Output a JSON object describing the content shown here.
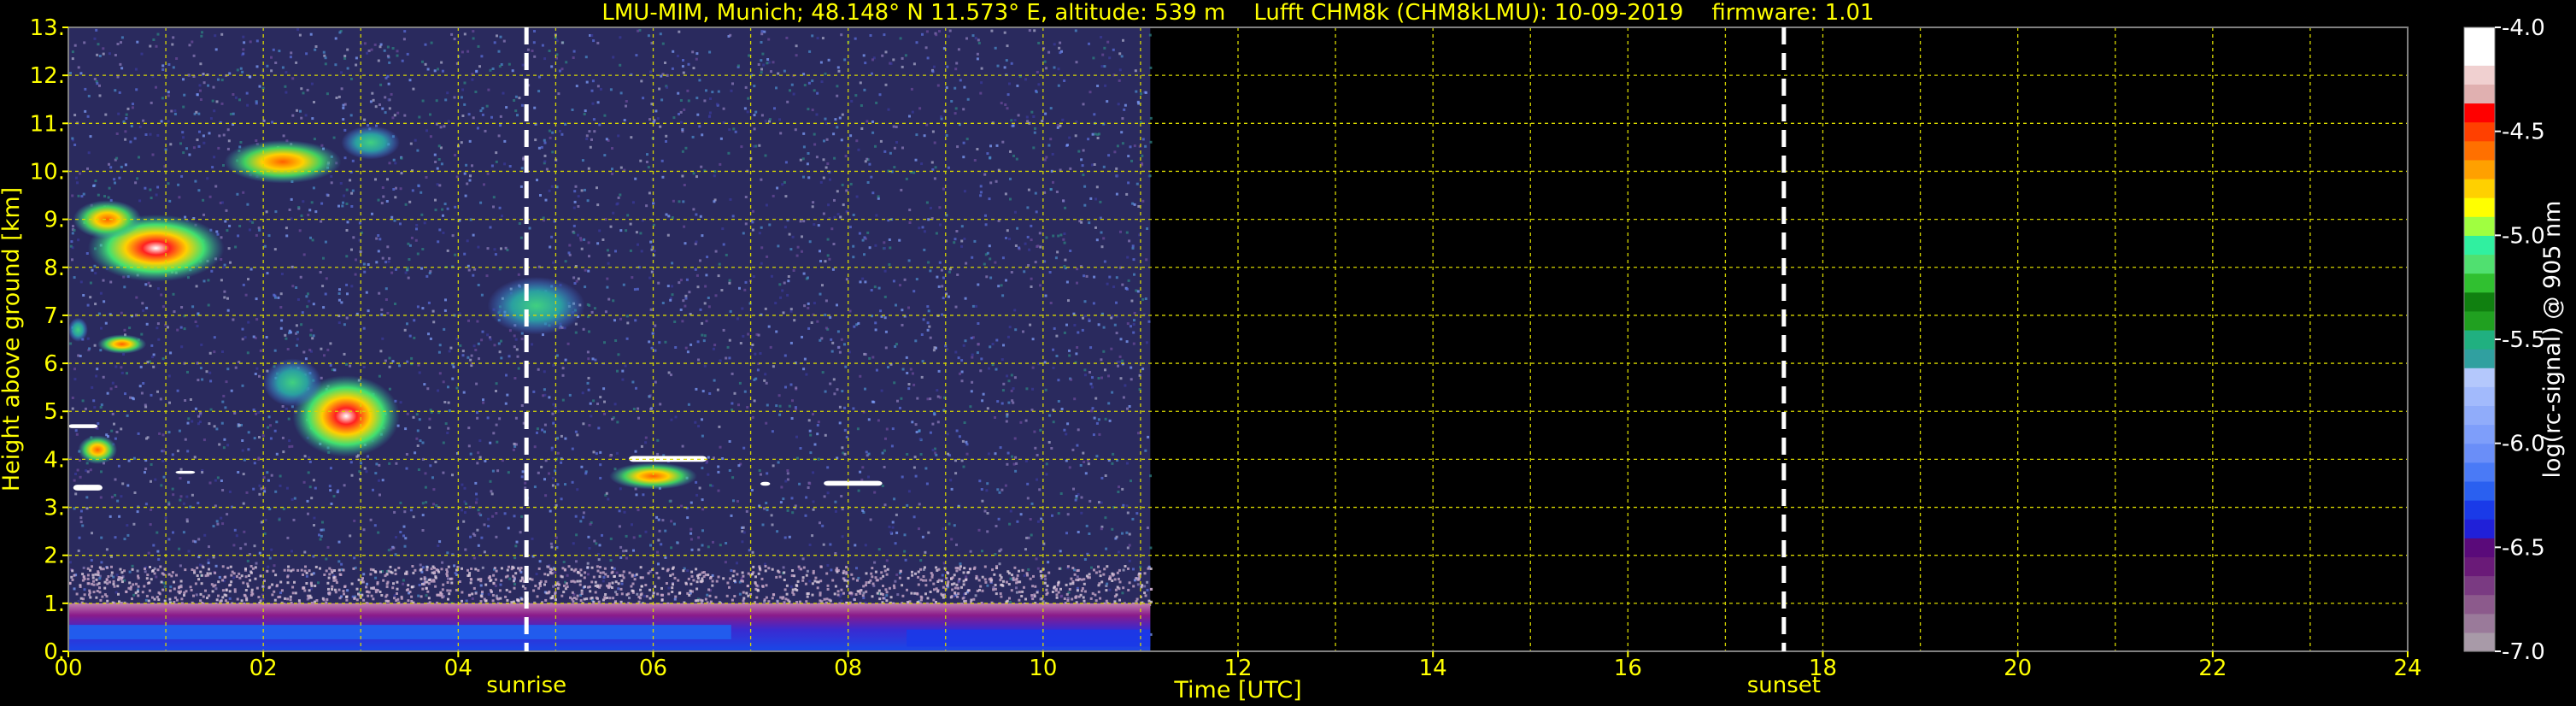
{
  "chart_data": {
    "type": "heatmap",
    "title": "LMU-MIM, Munich; 48.148° N 11.573° E, altitude: 539 m    Lufft CHM8k (CHM8kLMU): 10-09-2019    firmware: 1.01",
    "xlabel": "Time [UTC]",
    "ylabel": "Height above ground [km]",
    "xlim": [
      0,
      24
    ],
    "ylim": [
      0,
      13
    ],
    "x_ticks": [
      "00",
      "02",
      "04",
      "06",
      "08",
      "10",
      "12",
      "14",
      "16",
      "18",
      "20",
      "22",
      "24"
    ],
    "y_ticks": [
      "0.",
      "1.",
      "2.",
      "3.",
      "4.",
      "5.",
      "6.",
      "7.",
      "8.",
      "9.",
      "10.",
      "11.",
      "12.",
      "13."
    ],
    "grid": true,
    "data_end_hour": 11.1,
    "markers": [
      {
        "label": "sunrise",
        "hour": 4.7
      },
      {
        "label": "sunset",
        "hour": 17.6
      }
    ],
    "colorbar": {
      "label": "log(rc-signal) @ 905 nm",
      "range": [
        -7.0,
        -4.0
      ],
      "ticks": [
        "-4.0",
        "-4.5",
        "-5.0",
        "-5.5",
        "-6.0",
        "-6.5",
        "-7.0"
      ],
      "colors": [
        "#a89aa8",
        "#9a7a9a",
        "#8c5a8c",
        "#7a3a82",
        "#6a1a78",
        "#5a0a7a",
        "#2020d8",
        "#1a3ae8",
        "#2a60f0",
        "#4a7af6",
        "#6a8ef8",
        "#7e9efa",
        "#90acfa",
        "#a2bafc",
        "#b4c8fc",
        "#30a0a0",
        "#20b080",
        "#20a020",
        "#108010",
        "#30c030",
        "#50e070",
        "#30f0a0",
        "#a0ff40",
        "#ffff00",
        "#ffd000",
        "#ffa000",
        "#ff7000",
        "#ff4000",
        "#ff0000",
        "#e0b0b0",
        "#f0d0d0",
        "#ffffff",
        "#ffffff"
      ]
    }
  }
}
